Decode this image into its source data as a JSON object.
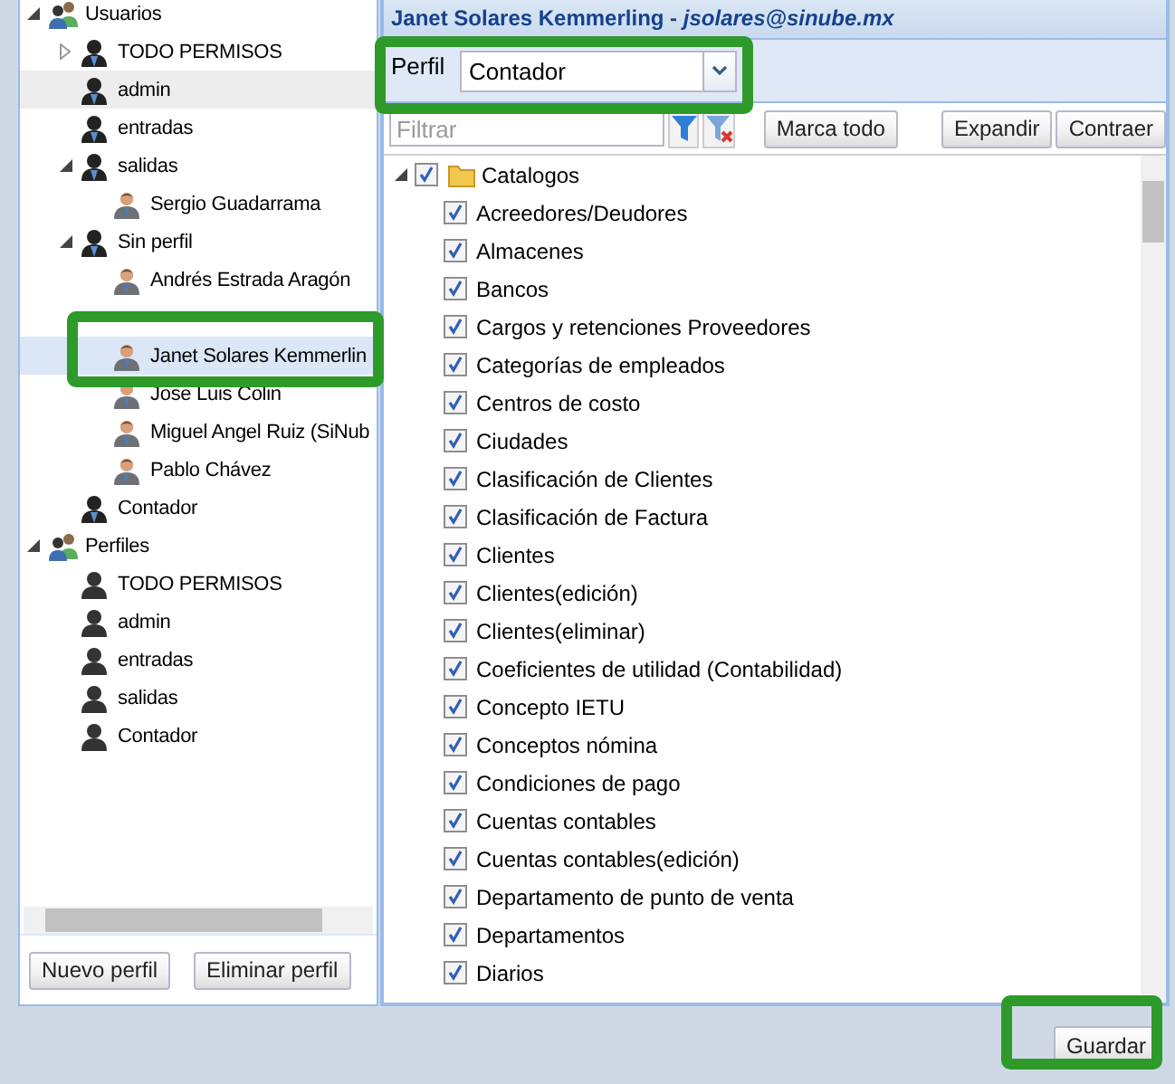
{
  "tree": [
    {
      "kind": "group",
      "label": "Usuarios",
      "expanded": true,
      "selected": false,
      "hovered": false,
      "children": [
        {
          "kind": "profile",
          "label": "TODO PERMISOS",
          "expanded": false,
          "selected": false,
          "hovered": false
        },
        {
          "kind": "profile",
          "label": "admin",
          "selected": false,
          "hovered": true
        },
        {
          "kind": "profile",
          "label": "entradas",
          "selected": false,
          "hovered": false
        },
        {
          "kind": "profile",
          "label": "salidas",
          "expanded": true,
          "selected": false,
          "hovered": false,
          "children": [
            {
              "kind": "person",
              "label": "Sergio Guadarrama",
              "selected": false,
              "hovered": false
            }
          ]
        },
        {
          "kind": "profile",
          "label": "Sin perfil",
          "expanded": true,
          "selected": false,
          "hovered": false,
          "children": [
            {
              "kind": "person",
              "label": "Andrés Estrada Aragón",
              "selected": false,
              "hovered": false
            },
            {
              "kind": "covered",
              "selected": false,
              "hovered": false
            },
            {
              "kind": "person",
              "label": "Janet Solares Kemmerlin",
              "selected": true,
              "hovered": false
            },
            {
              "kind": "person",
              "label": "Jose Luis Colin",
              "selected": false,
              "hovered": false
            },
            {
              "kind": "person",
              "label": "Miguel Angel Ruiz (SiNub",
              "selected": false,
              "hovered": false
            },
            {
              "kind": "person",
              "label": "Pablo Chávez",
              "selected": false,
              "hovered": false
            }
          ]
        },
        {
          "kind": "profile",
          "label": "Contador",
          "selected": false,
          "hovered": false
        }
      ]
    },
    {
      "kind": "group",
      "label": "Perfiles",
      "expanded": true,
      "selected": false,
      "hovered": false,
      "children": [
        {
          "kind": "role",
          "label": "TODO PERMISOS",
          "selected": false,
          "hovered": false
        },
        {
          "kind": "role",
          "label": "admin",
          "selected": false,
          "hovered": false
        },
        {
          "kind": "role",
          "label": "entradas",
          "selected": false,
          "hovered": false
        },
        {
          "kind": "role",
          "label": "salidas",
          "selected": false,
          "hovered": false
        },
        {
          "kind": "role",
          "label": "Contador",
          "selected": false,
          "hovered": false
        }
      ]
    }
  ],
  "left_buttons": [
    "Nuevo perfil",
    "Eliminar perfil"
  ],
  "header": {
    "name": "Janet Solares Kemmerling",
    "separator": " - ",
    "email": "jsolares@sinube.mx"
  },
  "profile": {
    "label": "Perfil",
    "value": "Contador"
  },
  "filter": {
    "placeholder": "Filtrar"
  },
  "toolbar_buttons": [
    "Marca todo",
    "Expandir",
    "Contraer"
  ],
  "permissions": {
    "label": "Catalogos",
    "expanded": true,
    "checked": true,
    "children": [
      {
        "label": "Acreedores/Deudores",
        "checked": true
      },
      {
        "label": "Almacenes",
        "checked": true
      },
      {
        "label": "Bancos",
        "checked": true
      },
      {
        "label": "Cargos y retenciones Proveedores",
        "checked": true
      },
      {
        "label": "Categorías de empleados",
        "checked": true
      },
      {
        "label": "Centros de costo",
        "checked": true
      },
      {
        "label": "Ciudades",
        "checked": true
      },
      {
        "label": "Clasificación de Clientes",
        "checked": true
      },
      {
        "label": "Clasificación de Factura",
        "checked": true
      },
      {
        "label": "Clientes",
        "checked": true
      },
      {
        "label": "Clientes(edición)",
        "checked": true
      },
      {
        "label": "Clientes(eliminar)",
        "checked": true
      },
      {
        "label": "Coeficientes de utilidad (Contabilidad)",
        "checked": true
      },
      {
        "label": "Concepto IETU",
        "checked": true
      },
      {
        "label": "Conceptos nómina",
        "checked": true
      },
      {
        "label": "Condiciones de pago",
        "checked": true
      },
      {
        "label": "Cuentas contables",
        "checked": true
      },
      {
        "label": "Cuentas contables(edición)",
        "checked": true
      },
      {
        "label": "Departamento de punto de venta",
        "checked": true
      },
      {
        "label": "Departamentos",
        "checked": true
      },
      {
        "label": "Diarios",
        "checked": true
      }
    ]
  },
  "save_button": "Guardar"
}
